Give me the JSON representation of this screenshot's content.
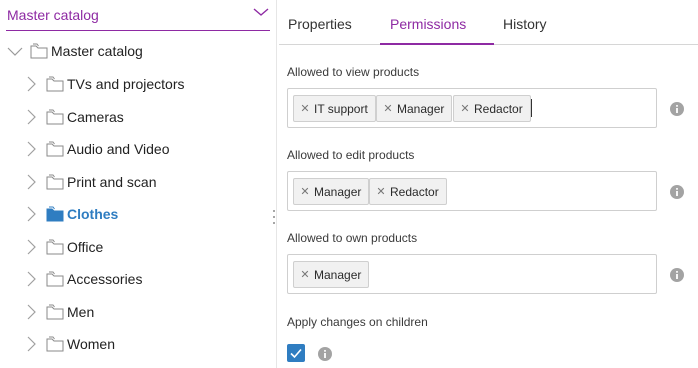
{
  "catalog_select": {
    "value": "Master catalog",
    "icon": "chevron-down-icon"
  },
  "tree": {
    "root": {
      "label": "Master catalog"
    },
    "items": [
      {
        "label": "TVs and projectors",
        "selected": false
      },
      {
        "label": "Cameras",
        "selected": false
      },
      {
        "label": "Audio and Video",
        "selected": false
      },
      {
        "label": "Print and scan",
        "selected": false
      },
      {
        "label": "Clothes",
        "selected": true
      },
      {
        "label": "Office",
        "selected": false
      },
      {
        "label": "Accessories",
        "selected": false
      },
      {
        "label": "Men",
        "selected": false
      },
      {
        "label": "Women",
        "selected": false
      }
    ]
  },
  "tabs": [
    {
      "label": "Properties",
      "active": false
    },
    {
      "label": "Permissions",
      "active": true
    },
    {
      "label": "History",
      "active": false
    }
  ],
  "permissions": {
    "view": {
      "label": "Allowed to view products",
      "tags": [
        "IT support",
        "Manager",
        "Redactor"
      ]
    },
    "edit": {
      "label": "Allowed to edit products",
      "tags": [
        "Manager",
        "Redactor"
      ]
    },
    "own": {
      "label": "Allowed to own products",
      "tags": [
        "Manager"
      ]
    },
    "apply_children": {
      "label": "Apply changes on children",
      "checked": true
    }
  },
  "colors": {
    "accent": "#8e2aa3",
    "selected": "#2f7dc1",
    "checkbox": "#2f7dc1"
  }
}
